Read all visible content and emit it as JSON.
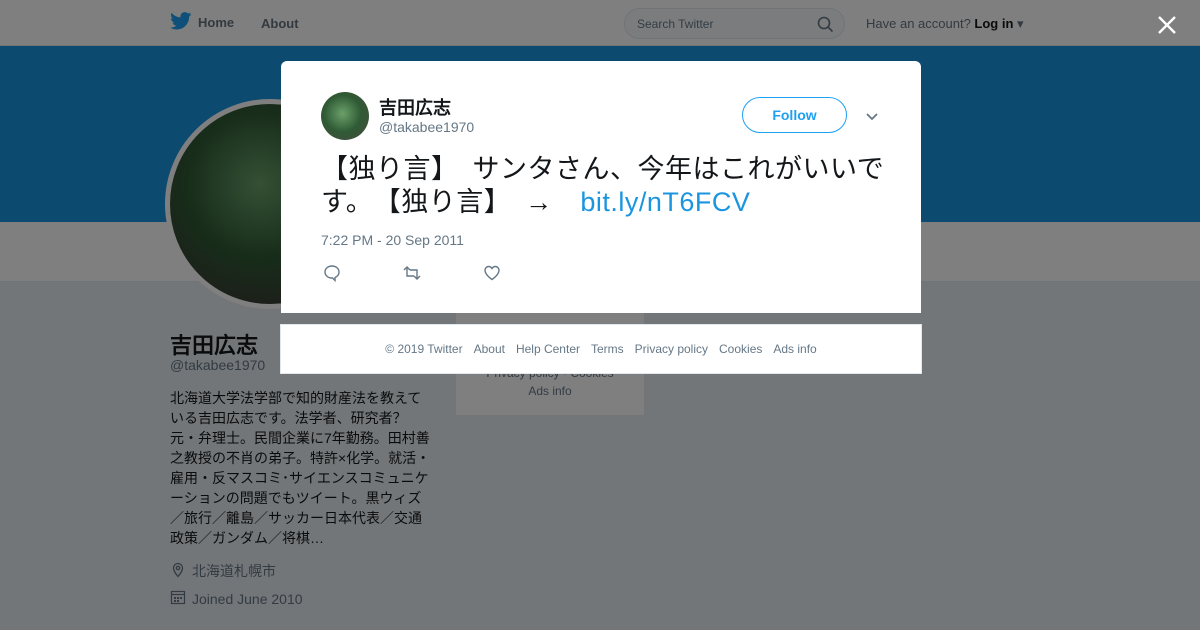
{
  "nav": {
    "home_label": "Home",
    "about_label": "About",
    "search_placeholder": "Search Twitter",
    "account_prompt": "Have an account?",
    "login_label": "Log in"
  },
  "profile": {
    "name": "吉田広志",
    "handle": "@takabee1970",
    "bio": "北海道大学法学部で知的財産法を教えている吉田広志です。法学者、研究者？元・弁理士。民間企業に7年勤務。田村善之教授の不肖の弟子。特許×化学。就活・雇用・反マスコミ･サイエンスコミュニケーションの問題でもツイート。黒ウィズ／旅行／離島／サッカー日本代表／交通政策／ガンダム／将棋…",
    "location": "北海道札幌市",
    "joined": "Joined June 2010"
  },
  "sidebar_box": {
    "line1": "Privacy policy · Cookies",
    "line2": "Ads info"
  },
  "tweet": {
    "name": "吉田広志",
    "handle": "@takabee1970",
    "follow_label": "Follow",
    "text": "【独り言】　サンタさん、今年はこれがいいです。　【独り言】　→　",
    "link": "bit.ly/nT6FCV",
    "timestamp": "7:22 PM - 20 Sep 2011"
  },
  "footer": {
    "items": [
      "© 2019 Twitter",
      "About",
      "Help Center",
      "Terms",
      "Privacy policy",
      "Cookies",
      "Ads info"
    ]
  },
  "colors": {
    "accent": "#1da1f2",
    "banner": "#1b95e0",
    "link": "#1b95e0"
  }
}
